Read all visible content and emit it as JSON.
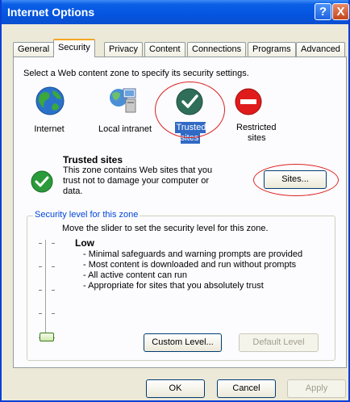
{
  "window": {
    "title": "Internet Options",
    "help_label": "?",
    "close_label": "X"
  },
  "tabs": [
    {
      "label": "General"
    },
    {
      "label": "Security"
    },
    {
      "label": "Privacy"
    },
    {
      "label": "Content"
    },
    {
      "label": "Connections"
    },
    {
      "label": "Programs"
    },
    {
      "label": "Advanced"
    }
  ],
  "security": {
    "instruction": "Select a Web content zone to specify its security settings.",
    "zones": [
      {
        "label": "Internet",
        "icon": "globe-icon"
      },
      {
        "label": "Local intranet",
        "icon": "intranet-icon"
      },
      {
        "label": "Trusted sites",
        "icon": "trusted-sites-icon",
        "selected": true
      },
      {
        "label_line1": "Restricted",
        "label_line2": "sites",
        "icon": "restricted-sites-icon"
      }
    ],
    "zone_detail": {
      "title": "Trusted sites",
      "desc_line1": "This zone contains Web sites that you",
      "desc_line2": "trust not to damage your computer or",
      "desc_line3": "data.",
      "sites_button": "Sites..."
    },
    "level_group": {
      "legend": "Security level for this zone",
      "instruction": "Move the slider to set the security level for this zone.",
      "level_name": "Low",
      "bullets": [
        "- Minimal safeguards and warning prompts are provided",
        "- Most content is downloaded and run without prompts",
        "- All active content can run",
        "- Appropriate for sites that you absolutely trust"
      ],
      "custom_button": "Custom Level...",
      "default_button": "Default Level"
    }
  },
  "footer": {
    "ok": "OK",
    "cancel": "Cancel",
    "apply": "Apply"
  },
  "colors": {
    "title_bar": "#0555e0",
    "selection": "#316ac5",
    "annotation": "#dd2222",
    "group_legend": "#0046d5"
  }
}
